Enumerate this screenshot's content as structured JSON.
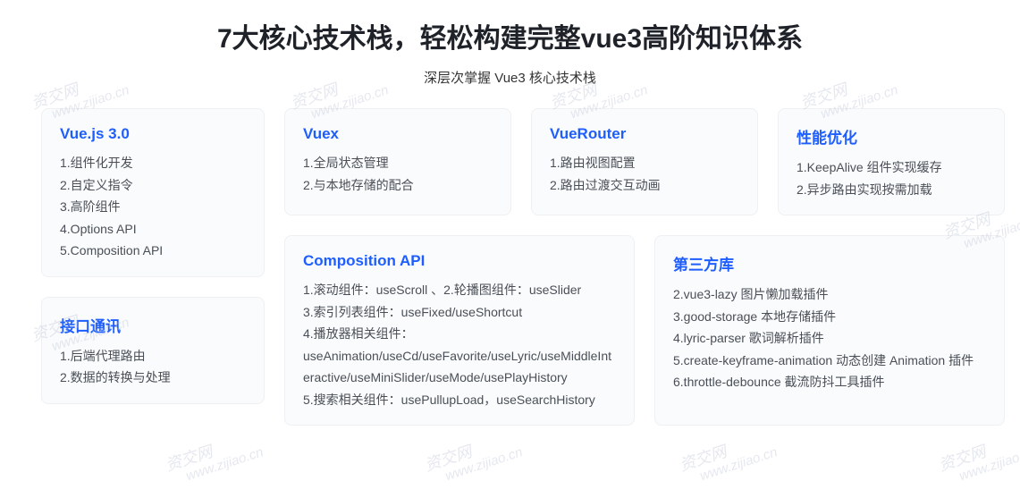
{
  "header": {
    "title": "7大核心技术栈，轻松构建完整vue3高阶知识体系",
    "subtitle": "深层次掌握 Vue3 核心技术栈"
  },
  "cards": {
    "vuejs": {
      "title": "Vue.js 3.0",
      "items": [
        "1.组件化开发",
        "2.自定义指令",
        "3.高阶组件",
        "4.Options API",
        "5.Composition API"
      ]
    },
    "api_comm": {
      "title": "接口通讯",
      "items": [
        "1.后端代理路由",
        "2.数据的转换与处理"
      ]
    },
    "vuex": {
      "title": "Vuex",
      "items": [
        "1.全局状态管理",
        "2.与本地存储的配合"
      ]
    },
    "vuerouter": {
      "title": "VueRouter",
      "items": [
        "1.路由视图配置",
        "2.路由过渡交互动画"
      ]
    },
    "perf": {
      "title": "性能优化",
      "items": [
        "1.KeepAlive 组件实现缓存",
        "2.异步路由实现按需加载"
      ]
    },
    "composition": {
      "title": "Composition API",
      "items": [
        "1.滚动组件：useScroll 、2.轮播图组件：useSlider",
        "3.索引列表组件：useFixed/useShortcut",
        "4.播放器相关组件：useAnimation/useCd/useFavorite/useLyric/useMiddleInteractive/useMiniSlider/useMode/usePlayHistory",
        "5.搜索相关组件：usePullupLoad，useSearchHistory"
      ]
    },
    "thirdparty": {
      "title": "第三方库",
      "items": [
        "2.vue3-lazy 图片懒加载插件",
        "3.good-storage 本地存储插件",
        "4.lyric-parser 歌词解析插件",
        "5.create-keyframe-animation 动态创建 Animation 插件",
        "6.throttle-debounce 截流防抖工具插件"
      ]
    }
  },
  "watermark": {
    "text": "资交网",
    "url": "www.zijiao.cn"
  }
}
